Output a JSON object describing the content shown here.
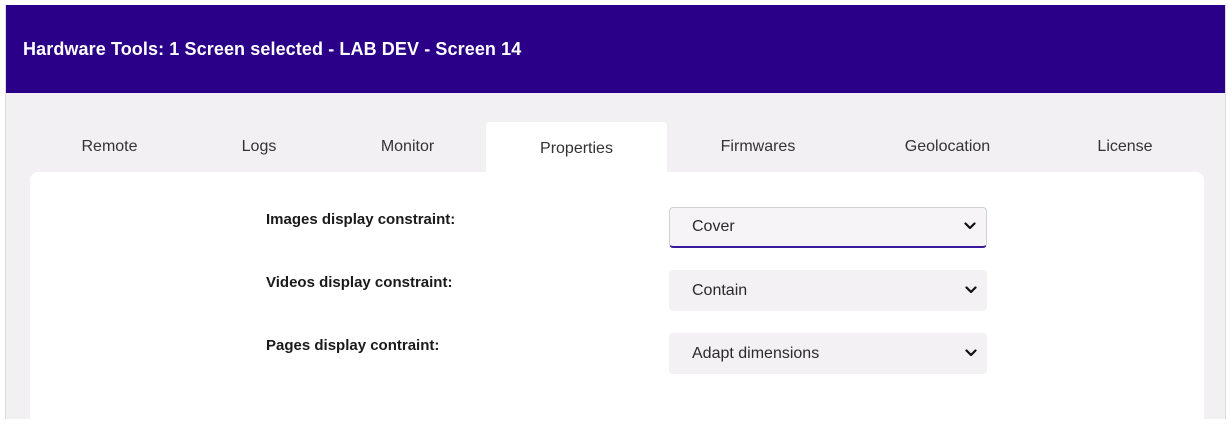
{
  "header": {
    "title": "Hardware Tools: 1 Screen selected - LAB DEV - Screen 14"
  },
  "tabs": [
    {
      "label": "Remote",
      "active": false
    },
    {
      "label": "Logs",
      "active": false
    },
    {
      "label": "Monitor",
      "active": false
    },
    {
      "label": "Properties",
      "active": true
    },
    {
      "label": "Firmwares",
      "active": false
    },
    {
      "label": "Geolocation",
      "active": false
    },
    {
      "label": "License",
      "active": false
    }
  ],
  "properties": {
    "images": {
      "label": "Images display constraint:",
      "value": "Cover",
      "icon": "chevron-down-icon"
    },
    "videos": {
      "label": "Videos display constraint:",
      "value": "Contain",
      "icon": "chevron-down-icon"
    },
    "pages": {
      "label": "Pages display contraint:",
      "value": "Adapt dimensions",
      "icon": "chevron-down-icon"
    }
  },
  "colors": {
    "header_bg": "#290087",
    "header_text": "#ffffff",
    "page_bg": "#f2f0f2",
    "panel_bg": "#ffffff",
    "focus_accent": "#3a1a9a"
  }
}
